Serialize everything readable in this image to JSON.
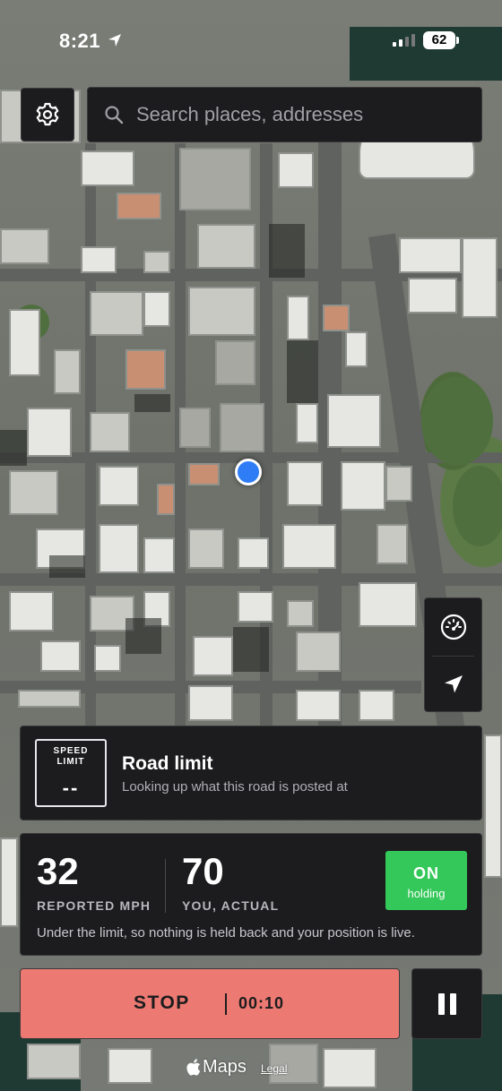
{
  "status_bar": {
    "time": "8:21",
    "battery": "62"
  },
  "search": {
    "placeholder": "Search places, addresses"
  },
  "road_card": {
    "sign_caption_line1": "SPEED",
    "sign_caption_line2": "LIMIT",
    "sign_value": "--",
    "title": "Road limit",
    "subtitle": "Looking up what this road is posted at"
  },
  "speed_card": {
    "reported_speed": "32",
    "reported_label": "REPORTED MPH",
    "actual_speed": "70",
    "actual_label": "YOU, ACTUAL",
    "badge_state": "ON",
    "badge_sub": "holding",
    "note": "Under the limit, so nothing is held back and your position is live."
  },
  "controls": {
    "stop_label": "STOP",
    "timer": "00:10"
  },
  "footer": {
    "maps_label": "Maps",
    "legal_label": "Legal"
  },
  "icons": {
    "settings": "gear-icon",
    "search": "search-icon",
    "speedometer": "speedometer-icon",
    "location": "location-arrow-icon",
    "pause": "pause-icon",
    "apple": "apple-icon"
  },
  "colors": {
    "stop": "#ec7a72",
    "on_badge": "#34c759",
    "user_dot": "#2f7df6",
    "panel": "#1c1c1e"
  }
}
